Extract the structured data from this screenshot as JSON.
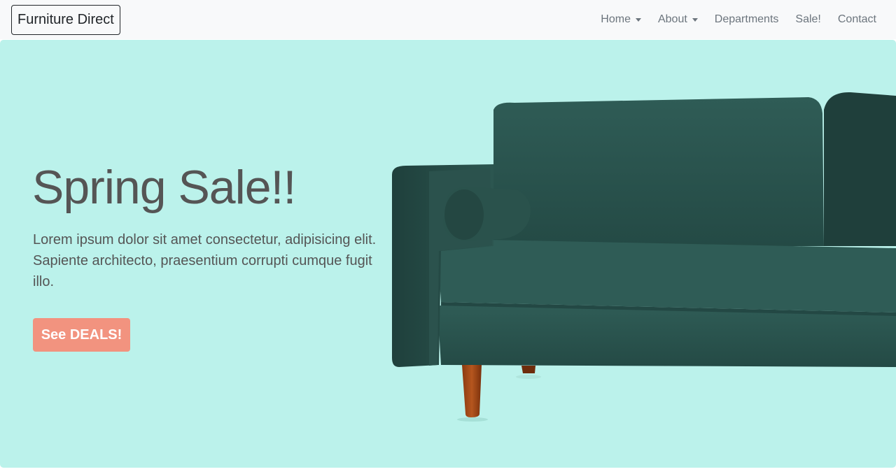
{
  "navbar": {
    "brand": "Furniture Direct",
    "items": [
      {
        "label": "Home",
        "dropdown": true
      },
      {
        "label": "About",
        "dropdown": true
      },
      {
        "label": "Departments",
        "dropdown": false
      },
      {
        "label": "Sale!",
        "dropdown": false
      },
      {
        "label": "Contact",
        "dropdown": false
      }
    ]
  },
  "hero": {
    "title": "Spring Sale!!",
    "text": "Lorem ipsum dolor sit amet consectetur, adipisicing elit. Sapiente architecto, praesentium corrupti cumque fugit illo.",
    "button_label": "See DEALS!",
    "image": "green-velvet-sofa"
  },
  "colors": {
    "navbar_bg": "#f8f9fa",
    "hero_bg": "#bbf2eb",
    "button_bg": "#f2937f",
    "text": "#555555",
    "sofa_green": "#2f5a54"
  }
}
